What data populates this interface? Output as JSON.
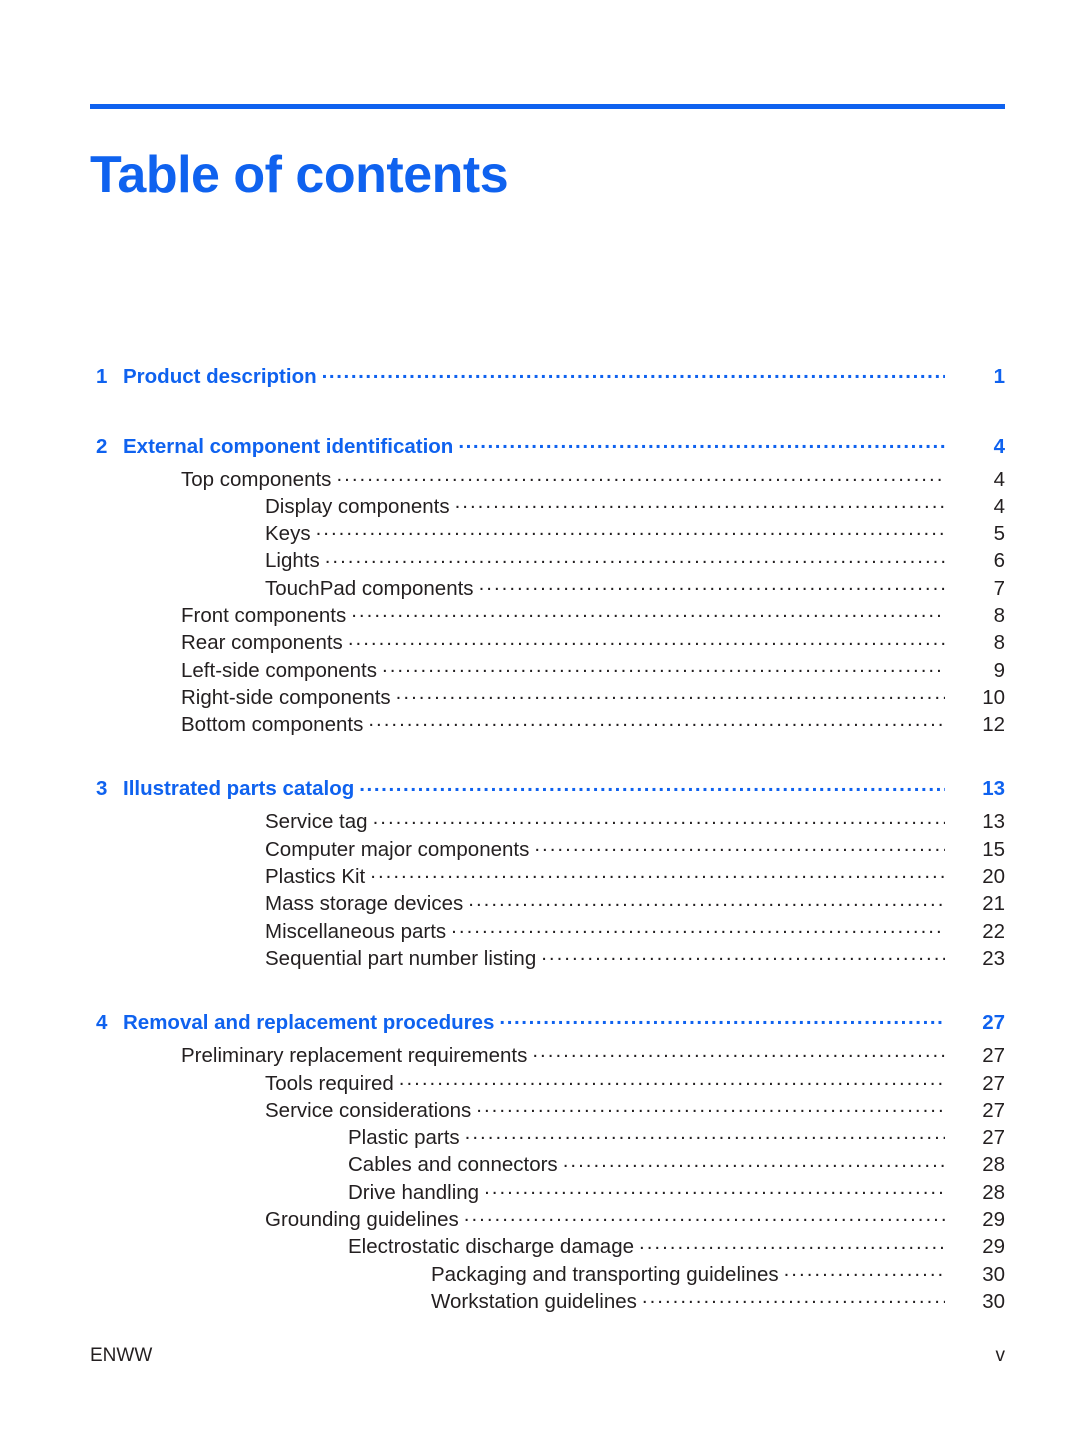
{
  "document": {
    "title": "Table of contents",
    "accent_color": "#0f62ef",
    "text_color": "#231f20"
  },
  "footer": {
    "left": "ENWW",
    "right": "v"
  },
  "toc": {
    "chapters": [
      {
        "number": "1",
        "title": "Product description",
        "page": "1",
        "entries": []
      },
      {
        "number": "2",
        "title": "External component identification",
        "page": "4",
        "entries": [
          {
            "level": 1,
            "label": "Top components",
            "page": "4"
          },
          {
            "level": 2,
            "label": "Display components",
            "page": "4"
          },
          {
            "level": 2,
            "label": "Keys",
            "page": "5"
          },
          {
            "level": 2,
            "label": "Lights",
            "page": "6"
          },
          {
            "level": 2,
            "label": "TouchPad components",
            "page": "7"
          },
          {
            "level": 1,
            "label": "Front components",
            "page": "8"
          },
          {
            "level": 1,
            "label": "Rear components",
            "page": "8"
          },
          {
            "level": 1,
            "label": "Left-side components",
            "page": "9"
          },
          {
            "level": 1,
            "label": "Right-side components",
            "page": "10"
          },
          {
            "level": 1,
            "label": "Bottom components",
            "page": "12"
          }
        ]
      },
      {
        "number": "3",
        "title": "Illustrated parts catalog",
        "page": "13",
        "entries": [
          {
            "level": 2,
            "label": "Service tag",
            "page": "13"
          },
          {
            "level": 2,
            "label": "Computer major components",
            "page": "15"
          },
          {
            "level": 2,
            "label": "Plastics Kit",
            "page": "20"
          },
          {
            "level": 2,
            "label": "Mass storage devices",
            "page": "21"
          },
          {
            "level": 2,
            "label": "Miscellaneous parts",
            "page": "22"
          },
          {
            "level": 2,
            "label": "Sequential part number listing",
            "page": "23"
          }
        ]
      },
      {
        "number": "4",
        "title": "Removal and replacement procedures",
        "page": "27",
        "entries": [
          {
            "level": 1,
            "label": "Preliminary replacement requirements",
            "page": "27"
          },
          {
            "level": 2,
            "label": "Tools required",
            "page": "27"
          },
          {
            "level": 2,
            "label": "Service considerations",
            "page": "27"
          },
          {
            "level": 3,
            "label": "Plastic parts",
            "page": "27"
          },
          {
            "level": 3,
            "label": "Cables and connectors",
            "page": "28"
          },
          {
            "level": 3,
            "label": "Drive handling",
            "page": "28"
          },
          {
            "level": 2,
            "label": "Grounding guidelines",
            "page": "29"
          },
          {
            "level": 3,
            "label": "Electrostatic discharge damage",
            "page": "29"
          },
          {
            "level": 4,
            "label": "Packaging and transporting guidelines",
            "page": "30"
          },
          {
            "level": 4,
            "label": "Workstation guidelines",
            "page": "30"
          }
        ]
      }
    ]
  }
}
